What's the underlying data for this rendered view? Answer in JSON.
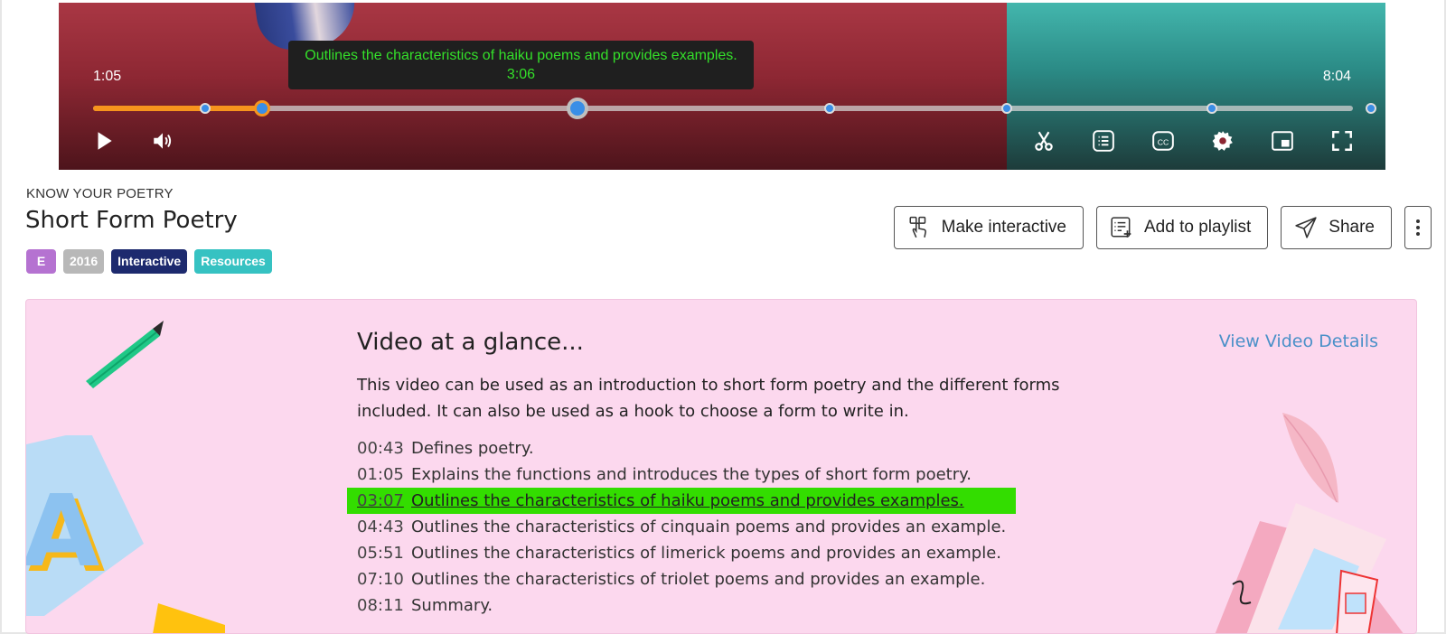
{
  "player": {
    "current_time": "1:05",
    "duration": "8:04",
    "tooltip_text": "Outlines the characteristics of haiku poems and provides examples.",
    "tooltip_time": "3:06",
    "progress_fraction": 0.134,
    "chapter_markers_seconds": [
      43,
      65,
      186,
      283,
      351,
      430,
      491
    ],
    "hover_marker_seconds": 186,
    "controls": [
      "play-icon",
      "volume-icon",
      "scissors-icon",
      "transcript-icon",
      "closed-captions-icon",
      "settings-icon",
      "picture-in-picture-icon",
      "fullscreen-icon"
    ],
    "colors": {
      "played": "#f7941d",
      "marker": "#3a8ee6",
      "tooltip_text": "#34e02a"
    }
  },
  "header": {
    "breadcrumb": "KNOW YOUR POETRY",
    "title": "Short Form Poetry",
    "badges": [
      {
        "label": "E",
        "color": "#b572d1"
      },
      {
        "label": "2016",
        "color": "#b8b8b8"
      },
      {
        "label": "Interactive",
        "color": "#1d2a6e"
      },
      {
        "label": "Resources",
        "color": "#36c2c2"
      }
    ],
    "actions": {
      "make_interactive": "Make interactive",
      "add_to_playlist": "Add to playlist",
      "share": "Share"
    }
  },
  "glance": {
    "title": "Video at a glance...",
    "view_details": "View Video Details",
    "description": "This video can be used as an introduction to short form poetry and the different forms included. It can also be used as a hook to choose a form to write in.",
    "chapters": [
      {
        "time": "00:43",
        "text": "Defines poetry.",
        "active": false
      },
      {
        "time": "01:05",
        "text": "Explains the functions and introduces the types of short form poetry.",
        "active": false
      },
      {
        "time": "03:07",
        "text": "Outlines the characteristics of haiku poems and provides examples.",
        "active": true
      },
      {
        "time": "04:43",
        "text": "Outlines the characteristics of cinquain poems and provides an example.",
        "active": false
      },
      {
        "time": "05:51",
        "text": "Outlines the characteristics of limerick poems and provides an example.",
        "active": false
      },
      {
        "time": "07:10",
        "text": "Outlines the characteristics of triolet poems and provides an example.",
        "active": false
      },
      {
        "time": "08:11",
        "text": "Summary.",
        "active": false
      }
    ],
    "colors": {
      "panel_bg": "#fcd8ee",
      "active_highlight": "#33dd00",
      "link": "#4a90c8"
    }
  }
}
